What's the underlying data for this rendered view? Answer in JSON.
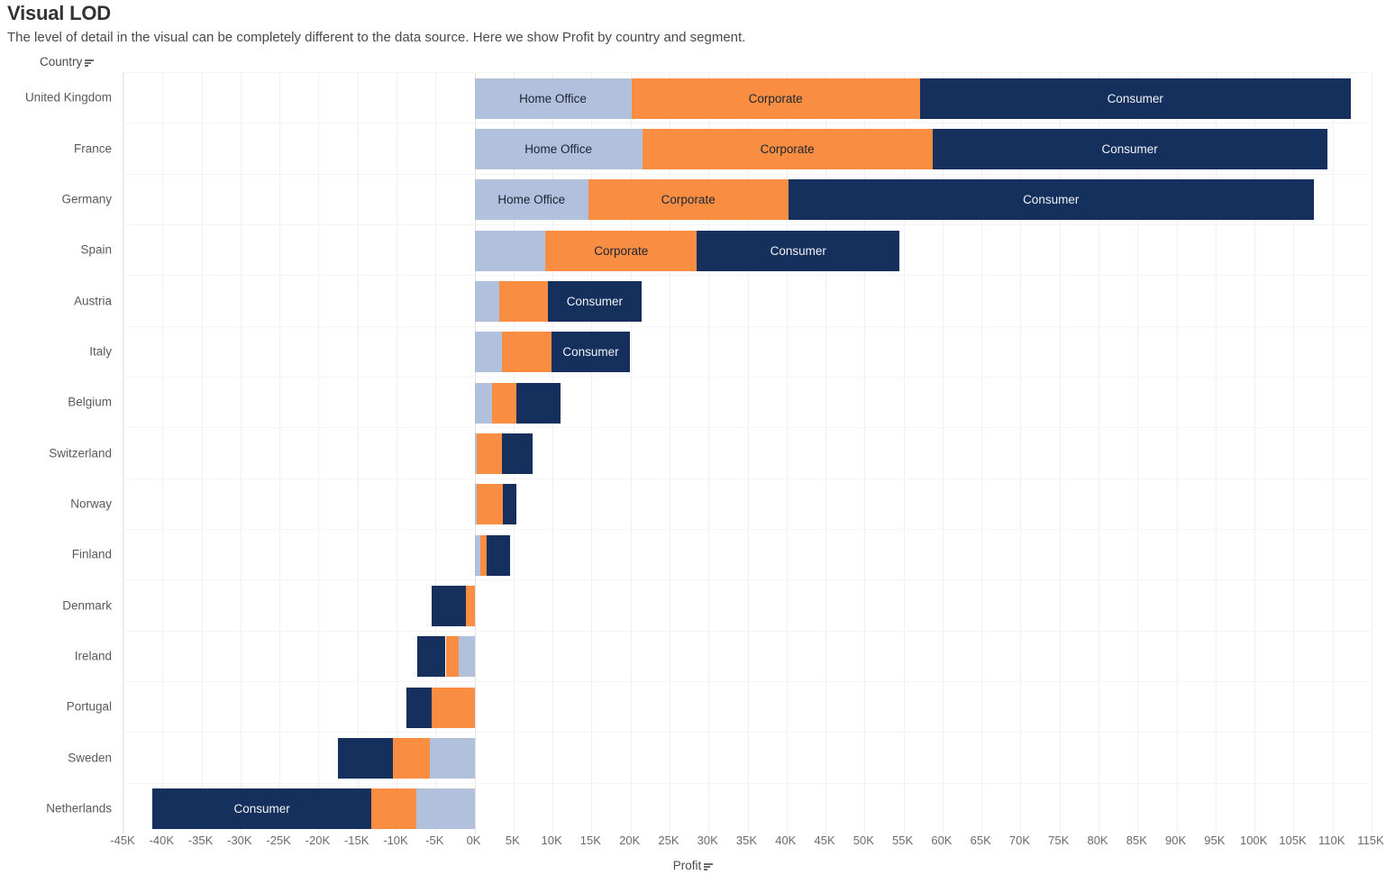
{
  "header": {
    "title": "Visual LOD",
    "subtitle": "The level of detail in the visual can be completely different to the data source. Here we show Profit by country and segment."
  },
  "axes": {
    "y_field_label": "Country",
    "x_field_label": "Profit"
  },
  "colors": {
    "home_office": "#b0c0dd",
    "corporate": "#f98e43",
    "consumer": "#15305c",
    "gridline": "#f0f0f0",
    "text": "#4a4a4a"
  },
  "segment_names": {
    "home_office": "Home Office",
    "corporate": "Corporate",
    "consumer": "Consumer"
  },
  "chart_data": {
    "type": "bar",
    "orientation": "horizontal",
    "stacked": true,
    "title": "Visual LOD",
    "subtitle": "The level of detail in the visual can be completely different to the data source. Here we show Profit by country and segment.",
    "xlabel": "Profit",
    "ylabel": "Country",
    "xlim": [
      -45000,
      115000
    ],
    "xtick_step": 5000,
    "grid": true,
    "legend": "none",
    "xtick_labels": [
      "-45K",
      "-40K",
      "-35K",
      "-30K",
      "-25K",
      "-20K",
      "-15K",
      "-10K",
      "-5K",
      "0K",
      "5K",
      "10K",
      "15K",
      "20K",
      "25K",
      "30K",
      "35K",
      "40K",
      "45K",
      "50K",
      "55K",
      "60K",
      "65K",
      "70K",
      "75K",
      "80K",
      "85K",
      "90K",
      "95K",
      "100K",
      "105K",
      "110K",
      "115K"
    ],
    "categories": [
      "United Kingdom",
      "France",
      "Germany",
      "Spain",
      "Austria",
      "Italy",
      "Belgium",
      "Switzerland",
      "Norway",
      "Finland",
      "Denmark",
      "Ireland",
      "Portugal",
      "Sweden",
      "Netherlands"
    ],
    "series": [
      {
        "name": "Home Office",
        "color": "#b0c0dd",
        "values": [
          20100,
          21500,
          14600,
          9100,
          3200,
          3500,
          2200,
          300,
          300,
          700,
          0,
          2000,
          0,
          5700,
          7400
        ]
      },
      {
        "name": "Corporate",
        "color": "#f98e43",
        "values": [
          37000,
          37200,
          25600,
          19400,
          6200,
          6400,
          3200,
          3200,
          3300,
          800,
          -1100,
          -1600,
          -5500,
          -4800,
          -5800
        ]
      },
      {
        "name": "Consumer",
        "color": "#15305c",
        "values": [
          55200,
          50600,
          67400,
          26000,
          12000,
          10000,
          5600,
          3900,
          1800,
          3100,
          -4400,
          -7300,
          -3200,
          -11800,
          -41300
        ]
      }
    ],
    "bar_segments": [
      {
        "country": "United Kingdom",
        "segments": [
          {
            "name": "Home Office",
            "start": 0,
            "end": 20100,
            "label_shown": true
          },
          {
            "name": "Corporate",
            "start": 20100,
            "end": 57100,
            "label_shown": true
          },
          {
            "name": "Consumer",
            "start": 57100,
            "end": 112300,
            "label_shown": true
          }
        ]
      },
      {
        "country": "France",
        "segments": [
          {
            "name": "Home Office",
            "start": 0,
            "end": 21500,
            "label_shown": true
          },
          {
            "name": "Corporate",
            "start": 21500,
            "end": 58700,
            "label_shown": true
          },
          {
            "name": "Consumer",
            "start": 58700,
            "end": 109300,
            "label_shown": true
          }
        ]
      },
      {
        "country": "Germany",
        "segments": [
          {
            "name": "Home Office",
            "start": 0,
            "end": 14600,
            "label_shown": true
          },
          {
            "name": "Corporate",
            "start": 14600,
            "end": 40200,
            "label_shown": true
          },
          {
            "name": "Consumer",
            "start": 40200,
            "end": 107600,
            "label_shown": true
          }
        ]
      },
      {
        "country": "Spain",
        "segments": [
          {
            "name": "Home Office",
            "start": 0,
            "end": 9100,
            "label_shown": false
          },
          {
            "name": "Corporate",
            "start": 9100,
            "end": 28500,
            "label_shown": true
          },
          {
            "name": "Consumer",
            "start": 28500,
            "end": 54500,
            "label_shown": true
          }
        ]
      },
      {
        "country": "Austria",
        "segments": [
          {
            "name": "Home Office",
            "start": 0,
            "end": 3200,
            "label_shown": false
          },
          {
            "name": "Corporate",
            "start": 3200,
            "end": 9400,
            "label_shown": false
          },
          {
            "name": "Consumer",
            "start": 9400,
            "end": 21400,
            "label_shown": true
          }
        ]
      },
      {
        "country": "Italy",
        "segments": [
          {
            "name": "Home Office",
            "start": 0,
            "end": 3500,
            "label_shown": false
          },
          {
            "name": "Corporate",
            "start": 3500,
            "end": 9900,
            "label_shown": false
          },
          {
            "name": "Consumer",
            "start": 9900,
            "end": 19900,
            "label_shown": true
          }
        ]
      },
      {
        "country": "Belgium",
        "segments": [
          {
            "name": "Home Office",
            "start": 0,
            "end": 2200,
            "label_shown": false
          },
          {
            "name": "Corporate",
            "start": 2200,
            "end": 5400,
            "label_shown": false
          },
          {
            "name": "Consumer",
            "start": 5400,
            "end": 11000,
            "label_shown": false
          }
        ]
      },
      {
        "country": "Switzerland",
        "segments": [
          {
            "name": "Home Office",
            "start": 0,
            "end": 300,
            "label_shown": false
          },
          {
            "name": "Corporate",
            "start": 300,
            "end": 3500,
            "label_shown": false
          },
          {
            "name": "Consumer",
            "start": 3500,
            "end": 7400,
            "label_shown": false
          }
        ]
      },
      {
        "country": "Norway",
        "segments": [
          {
            "name": "Home Office",
            "start": 0,
            "end": 300,
            "label_shown": false
          },
          {
            "name": "Corporate",
            "start": 300,
            "end": 3600,
            "label_shown": false
          },
          {
            "name": "Consumer",
            "start": 3600,
            "end": 5400,
            "label_shown": false
          }
        ]
      },
      {
        "country": "Finland",
        "segments": [
          {
            "name": "Home Office",
            "start": 0,
            "end": 700,
            "label_shown": false
          },
          {
            "name": "Corporate",
            "start": 700,
            "end": 1500,
            "label_shown": false
          },
          {
            "name": "Consumer",
            "start": 1500,
            "end": 4600,
            "label_shown": false
          }
        ]
      },
      {
        "country": "Denmark",
        "segments": [
          {
            "name": "Consumer",
            "start": -5500,
            "end": -1100,
            "label_shown": false
          },
          {
            "name": "Corporate",
            "start": -1100,
            "end": 0,
            "label_shown": false
          }
        ]
      },
      {
        "country": "Ireland",
        "segments": [
          {
            "name": "Consumer",
            "start": -7300,
            "end": -3700,
            "label_shown": false
          },
          {
            "name": "Corporate",
            "start": -3700,
            "end": -2000,
            "label_shown": false
          },
          {
            "name": "Home Office",
            "start": -2000,
            "end": 0,
            "label_shown": false
          }
        ]
      },
      {
        "country": "Portugal",
        "segments": [
          {
            "name": "Consumer",
            "start": -8700,
            "end": -5500,
            "label_shown": false
          },
          {
            "name": "Corporate",
            "start": -5500,
            "end": 0,
            "label_shown": false
          }
        ]
      },
      {
        "country": "Sweden",
        "segments": [
          {
            "name": "Consumer",
            "start": -17500,
            "end": -10500,
            "label_shown": false
          },
          {
            "name": "Corporate",
            "start": -10500,
            "end": -5700,
            "label_shown": false
          },
          {
            "name": "Home Office",
            "start": -5700,
            "end": 0,
            "label_shown": false
          }
        ]
      },
      {
        "country": "Netherlands",
        "segments": [
          {
            "name": "Consumer",
            "start": -41300,
            "end": -13200,
            "label_shown": true
          },
          {
            "name": "Corporate",
            "start": -13200,
            "end": -7400,
            "label_shown": false
          },
          {
            "name": "Home Office",
            "start": -7400,
            "end": 0,
            "label_shown": false
          }
        ]
      }
    ]
  }
}
